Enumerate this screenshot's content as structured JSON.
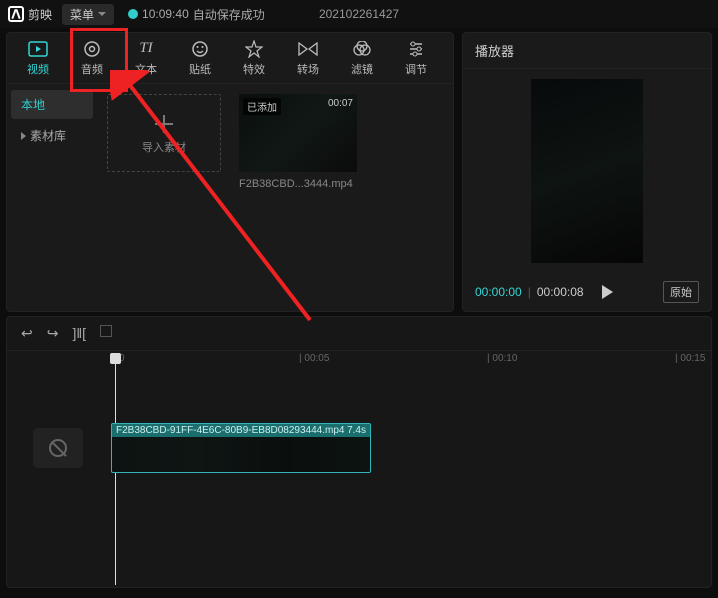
{
  "titlebar": {
    "app_name": "剪映",
    "menu_label": "菜单",
    "save_time": "10:09:40",
    "save_status": "自动保存成功",
    "project_name": "202102261427"
  },
  "tabs": [
    {
      "label": "视频",
      "icon": "video"
    },
    {
      "label": "音频",
      "icon": "audio"
    },
    {
      "label": "文本",
      "icon": "text"
    },
    {
      "label": "贴纸",
      "icon": "sticker"
    },
    {
      "label": "特效",
      "icon": "effects"
    },
    {
      "label": "转场",
      "icon": "transition"
    },
    {
      "label": "滤镜",
      "icon": "filter"
    },
    {
      "label": "调节",
      "icon": "adjust"
    }
  ],
  "active_tab_index": 0,
  "subtabs": [
    {
      "label": "本地",
      "active": true,
      "expand": false
    },
    {
      "label": "素材库",
      "active": false,
      "expand": true
    }
  ],
  "import_label": "导入素材",
  "clip_tile": {
    "badge": "已添加",
    "duration": "00:07",
    "filename": "F2B38CBD...3444.mp4"
  },
  "player": {
    "title": "播放器",
    "time_current": "00:00:00",
    "time_total": "00:00:08",
    "original_btn": "原始"
  },
  "timeline": {
    "marks": [
      "0",
      "00:05",
      "00:10",
      "00:15"
    ],
    "clip_name": "F2B38CBD-91FF-4E6C-80B9-EB8D08293444.mp4",
    "clip_dur": "7.4s"
  },
  "annotation": {
    "highlight_tab_index": 1
  }
}
